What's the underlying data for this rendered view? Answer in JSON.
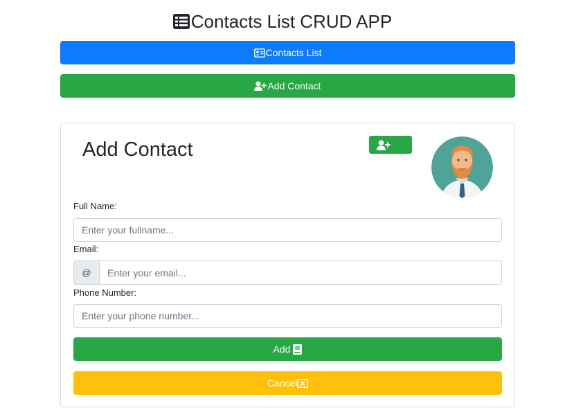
{
  "header": {
    "title": "Contacts List CRUD APP",
    "title_icon": "list-icon"
  },
  "nav": {
    "contacts_list_label": "Contacts List",
    "contacts_list_icon": "address-card-icon",
    "add_contact_label": "Add Contact",
    "add_contact_icon": "user-plus-icon"
  },
  "card": {
    "title": "Add Contact",
    "add_user_icon": "user-plus-icon",
    "avatar_icon": "bearded-man-avatar-icon",
    "form": {
      "fullname_label": "Full Name:",
      "fullname_placeholder": "Enter your fullname...",
      "fullname_value": "",
      "email_label": "Email:",
      "email_addon": "@",
      "email_placeholder": "Enter your email...",
      "email_value": "",
      "phone_label": "Phone Number:",
      "phone_placeholder": "Enter your phone number...",
      "phone_value": "",
      "submit_label": "Add",
      "submit_icon": "book-icon",
      "cancel_label": "Cancel",
      "cancel_icon": "close-box-icon"
    }
  },
  "colors": {
    "primary": "#0d7bfd",
    "success": "#28a745",
    "warning": "#ffc107",
    "avatar_bg": "#4fa398"
  }
}
